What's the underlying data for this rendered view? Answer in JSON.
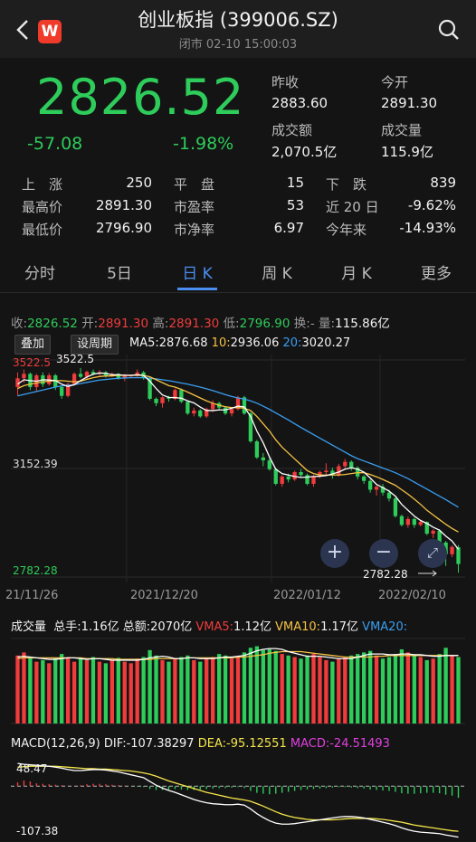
{
  "header": {
    "title": "创业板指 (399006.SZ)",
    "subtitle": "闭市 02-10 15:00:03",
    "logo_text": "W"
  },
  "quote": {
    "price": "2826.52",
    "change": "-57.08",
    "change_pct": "-1.98%",
    "prev_close_label": "昨收",
    "prev_close": "2883.60",
    "open_label": "今开",
    "open": "2891.30",
    "amount_label": "成交额",
    "amount": "2,070.5亿",
    "volume_label": "成交量",
    "volume": "115.9亿"
  },
  "stats": {
    "rise_label": "上　涨",
    "rise": "250",
    "flat_label": "平　盘",
    "flat": "15",
    "fall_label": "下　跌",
    "fall": "839",
    "high_label": "最高价",
    "high": "2891.30",
    "pe_label": "市盈率",
    "pe": "53",
    "d20_label": "近 20 日",
    "d20": "-9.62%",
    "low_label": "最低价",
    "low": "2796.90",
    "pb_label": "市净率",
    "pb": "6.97",
    "ytd_label": "今年来",
    "ytd": "-14.93%"
  },
  "tabs": [
    "分时",
    "5日",
    "日 K",
    "周 K",
    "月 K",
    "更多"
  ],
  "active_tab": "日 K",
  "kline_info": {
    "close_l": "收:",
    "close": "2826.52",
    "open_l": "开:",
    "open": "2891.30",
    "high_l": "高:",
    "high": "2891.30",
    "low_l": "低:",
    "low": "2796.90",
    "chg_l": "换:",
    "chg": "-",
    "vol_l": "量:",
    "vol": "115.86亿"
  },
  "buttons": {
    "overlay": "叠加",
    "period": "设周期"
  },
  "ma": {
    "ma5_l": "MA5:",
    "ma5": "2876.68",
    "ma10_l": "10:",
    "ma10": "2936.06",
    "ma20_l": "20:",
    "ma20": "3020.27"
  },
  "kaxis": {
    "top": "3522.5",
    "mid": "3152.39",
    "bottom": "2782.28",
    "low_marker": "2782.28"
  },
  "dates": [
    "21/11/26",
    "2021/12/20",
    "2022/01/12",
    "2022/02/10"
  ],
  "zoom": {
    "in": "+",
    "out": "−"
  },
  "vol_info": {
    "label": "成交量",
    "total_l": "总手:",
    "total": "1.16亿",
    "amount_l": "总额:",
    "amount": "2070亿",
    "vma5_l": "VMA5:",
    "vma5": "1.12亿",
    "vma10_l": "VMA10:",
    "vma10": "1.17亿",
    "vma20_l": "VMA20:"
  },
  "macd_info": {
    "label": "MACD(12,26,9)",
    "dif_l": "DIF:",
    "dif": "-107.38297",
    "dea_l": "DEA:",
    "dea": "-95.12551",
    "macd_l": "MACD:",
    "macd": "-24.51493"
  },
  "macd_axis": {
    "top": "48.47",
    "bottom": "-107.38"
  },
  "colors": {
    "up": "#f03c3c",
    "down": "#2ecc5a",
    "ma5": "#ffffff",
    "ma10": "#f5c244",
    "ma20": "#3a9ef0",
    "accent": "#4a8ef0"
  },
  "chart_data": {
    "type": "candlestick",
    "ylim": [
      2782.28,
      3522.5
    ],
    "candles": [
      [
        3430,
        3460,
        3400,
        3480
      ],
      [
        3460,
        3475,
        3445,
        3490
      ],
      [
        3475,
        3430,
        3420,
        3480
      ],
      [
        3430,
        3470,
        3415,
        3475
      ],
      [
        3470,
        3440,
        3430,
        3480
      ],
      [
        3440,
        3470,
        3435,
        3478
      ],
      [
        3470,
        3430,
        3420,
        3475
      ],
      [
        3430,
        3400,
        3390,
        3435
      ],
      [
        3400,
        3440,
        3395,
        3445
      ],
      [
        3440,
        3475,
        3435,
        3480
      ],
      [
        3475,
        3465,
        3460,
        3495
      ],
      [
        3465,
        3482,
        3455,
        3486
      ],
      [
        3482,
        3475,
        3470,
        3490
      ],
      [
        3475,
        3480,
        3470,
        3488
      ],
      [
        3480,
        3470,
        3462,
        3485
      ],
      [
        3470,
        3475,
        3465,
        3480
      ],
      [
        3475,
        3460,
        3455,
        3478
      ],
      [
        3460,
        3470,
        3450,
        3475
      ],
      [
        3470,
        3470,
        3460,
        3472
      ],
      [
        3470,
        3480,
        3465,
        3490
      ],
      [
        3480,
        3460,
        3455,
        3485
      ],
      [
        3460,
        3390,
        3385,
        3462
      ],
      [
        3390,
        3375,
        3365,
        3395
      ],
      [
        3375,
        3395,
        3360,
        3398
      ],
      [
        3395,
        3390,
        3380,
        3400
      ],
      [
        3390,
        3420,
        3385,
        3425
      ],
      [
        3420,
        3380,
        3375,
        3425
      ],
      [
        3380,
        3340,
        3335,
        3385
      ],
      [
        3340,
        3350,
        3330,
        3360
      ],
      [
        3350,
        3330,
        3325,
        3355
      ],
      [
        3330,
        3355,
        3325,
        3360
      ],
      [
        3355,
        3375,
        3345,
        3385
      ],
      [
        3375,
        3360,
        3352,
        3380
      ],
      [
        3360,
        3340,
        3335,
        3365
      ],
      [
        3340,
        3355,
        3330,
        3360
      ],
      [
        3355,
        3395,
        3350,
        3400
      ],
      [
        3395,
        3340,
        3335,
        3400
      ],
      [
        3340,
        3245,
        3240,
        3345
      ],
      [
        3245,
        3190,
        3185,
        3250
      ],
      [
        3190,
        3180,
        3160,
        3205
      ],
      [
        3180,
        3150,
        3145,
        3190
      ],
      [
        3150,
        3100,
        3095,
        3155
      ],
      [
        3100,
        3125,
        3090,
        3130
      ],
      [
        3125,
        3115,
        3105,
        3135
      ],
      [
        3115,
        3140,
        3110,
        3145
      ],
      [
        3140,
        3130,
        3120,
        3150
      ],
      [
        3130,
        3100,
        3095,
        3135
      ],
      [
        3100,
        3125,
        3090,
        3130
      ],
      [
        3125,
        3140,
        3120,
        3145
      ],
      [
        3140,
        3145,
        3130,
        3170
      ],
      [
        3145,
        3130,
        3118,
        3155
      ],
      [
        3130,
        3160,
        3125,
        3168
      ],
      [
        3160,
        3175,
        3150,
        3185
      ],
      [
        3175,
        3155,
        3145,
        3180
      ],
      [
        3155,
        3125,
        3115,
        3160
      ],
      [
        3125,
        3110,
        3100,
        3130
      ],
      [
        3110,
        3080,
        3070,
        3115
      ],
      [
        3080,
        3090,
        3060,
        3095
      ],
      [
        3090,
        3070,
        3060,
        3100
      ],
      [
        3070,
        3050,
        3040,
        3080
      ],
      [
        3050,
        2990,
        2985,
        3055
      ],
      [
        2990,
        2960,
        2955,
        2995
      ],
      [
        2960,
        2980,
        2950,
        2988
      ],
      [
        2980,
        2960,
        2950,
        2985
      ],
      [
        2960,
        2970,
        2955,
        2975
      ],
      [
        2970,
        2930,
        2925,
        2972
      ],
      [
        2930,
        2940,
        2915,
        2945
      ],
      [
        2940,
        2900,
        2895,
        2945
      ],
      [
        2900,
        2860,
        2820,
        2905
      ],
      [
        2860,
        2885,
        2850,
        2890
      ],
      [
        2883.6,
        2826.52,
        2796.9,
        2891.3
      ]
    ],
    "ma5": [
      3440,
      3455,
      3452,
      3450,
      3455,
      3454,
      3452,
      3440,
      3432,
      3438,
      3452,
      3464,
      3474,
      3478,
      3477,
      3472,
      3472,
      3470,
      3470,
      3472,
      3470,
      3450,
      3425,
      3403,
      3395,
      3394,
      3392,
      3383,
      3376,
      3362,
      3350,
      3350,
      3352,
      3352,
      3358,
      3365,
      3362,
      3330,
      3280,
      3240,
      3192,
      3150,
      3135,
      3130,
      3125,
      3122,
      3123,
      3125,
      3126,
      3128,
      3134,
      3140,
      3150,
      3155,
      3150,
      3140,
      3120,
      3098,
      3087,
      3075,
      3058,
      3030,
      3010,
      2990,
      2975,
      2965,
      2952,
      2942,
      2922,
      2905,
      2876.68
    ],
    "ma10": [
      3425,
      3435,
      3440,
      3444,
      3448,
      3450,
      3452,
      3452,
      3450,
      3448,
      3450,
      3456,
      3462,
      3466,
      3468,
      3468,
      3470,
      3470,
      3470,
      3470,
      3470,
      3465,
      3455,
      3445,
      3435,
      3430,
      3422,
      3413,
      3403,
      3393,
      3383,
      3375,
      3368,
      3363,
      3360,
      3360,
      3358,
      3350,
      3330,
      3305,
      3280,
      3250,
      3225,
      3205,
      3185,
      3165,
      3145,
      3135,
      3130,
      3130,
      3130,
      3130,
      3132,
      3135,
      3138,
      3138,
      3132,
      3124,
      3115,
      3105,
      3095,
      3080,
      3065,
      3048,
      3030,
      3010,
      2994,
      2978,
      2962,
      2948,
      2936.06
    ],
    "ma20": [
      3400,
      3405,
      3410,
      3415,
      3420,
      3425,
      3430,
      3434,
      3436,
      3438,
      3442,
      3446,
      3450,
      3454,
      3456,
      3458,
      3460,
      3461,
      3462,
      3462,
      3462,
      3460,
      3458,
      3455,
      3452,
      3448,
      3444,
      3440,
      3435,
      3430,
      3424,
      3418,
      3411,
      3404,
      3398,
      3393,
      3389,
      3383,
      3375,
      3365,
      3354,
      3342,
      3330,
      3318,
      3305,
      3292,
      3280,
      3268,
      3256,
      3244,
      3232,
      3220,
      3208,
      3196,
      3186,
      3178,
      3170,
      3162,
      3154,
      3146,
      3138,
      3128,
      3118,
      3106,
      3094,
      3082,
      3070,
      3058,
      3046,
      3033,
      3020.27
    ],
    "volumes": [
      88,
      92,
      85,
      80,
      82,
      78,
      85,
      90,
      86,
      80,
      84,
      82,
      86,
      80,
      78,
      82,
      85,
      80,
      78,
      84,
      86,
      95,
      88,
      82,
      80,
      84,
      86,
      88,
      82,
      80,
      84,
      86,
      90,
      88,
      84,
      86,
      92,
      98,
      100,
      95,
      96,
      94,
      90,
      88,
      86,
      84,
      88,
      90,
      86,
      82,
      80,
      84,
      86,
      88,
      90,
      92,
      94,
      88,
      84,
      86,
      90,
      96,
      92,
      88,
      86,
      82,
      84,
      90,
      98,
      88,
      86
    ],
    "vma5": [
      86,
      87,
      86,
      85,
      84,
      83,
      83,
      84,
      85,
      85,
      84,
      83,
      84,
      84,
      83,
      82,
      82,
      82,
      82,
      82,
      83,
      85,
      86,
      87,
      86,
      84,
      84,
      85,
      85,
      84,
      84,
      84,
      85,
      86,
      86,
      87,
      88,
      91,
      94,
      96,
      97,
      97,
      96,
      93,
      91,
      89,
      87,
      87,
      87,
      86,
      85,
      84,
      84,
      84,
      86,
      88,
      90,
      90,
      90,
      89,
      89,
      90,
      90,
      89,
      89,
      88,
      87,
      87,
      88,
      88,
      88
    ],
    "vma10": [
      84,
      85,
      85,
      85,
      85,
      85,
      85,
      85,
      85,
      85,
      85,
      84,
      84,
      84,
      84,
      84,
      83,
      83,
      83,
      83,
      83,
      83,
      84,
      84,
      84,
      84,
      84,
      85,
      85,
      85,
      85,
      85,
      85,
      85,
      85,
      86,
      86,
      87,
      88,
      89,
      91,
      92,
      93,
      93,
      93,
      93,
      92,
      91,
      90,
      89,
      88,
      87,
      86,
      86,
      86,
      86,
      86,
      87,
      87,
      88,
      88,
      88,
      88,
      88,
      88,
      88,
      88,
      88,
      88,
      88,
      88
    ],
    "macd_hist": [
      8,
      12,
      10,
      6,
      5,
      4,
      3,
      2,
      1,
      0,
      2,
      4,
      5,
      5,
      4,
      3,
      2,
      1,
      0,
      -1,
      -2,
      -6,
      -8,
      -8,
      -7,
      -6,
      -7,
      -8,
      -8,
      -7,
      -6,
      -5,
      -4,
      -4,
      -3,
      -2,
      -4,
      -10,
      -14,
      -16,
      -17,
      -16,
      -14,
      -12,
      -10,
      -8,
      -7,
      -6,
      -5,
      -4,
      -3,
      -2,
      -2,
      -3,
      -4,
      -5,
      -7,
      -8,
      -9,
      -10,
      -12,
      -15,
      -16,
      -16,
      -15,
      -14,
      -14,
      -15,
      -18,
      -20,
      -24.5
    ],
    "dif": [
      48,
      46,
      45,
      44,
      43,
      42,
      40,
      38,
      35,
      33,
      33,
      34,
      35,
      35,
      34,
      32,
      30,
      27,
      24,
      21,
      18,
      10,
      2,
      -4,
      -9,
      -13,
      -18,
      -23,
      -28,
      -32,
      -35,
      -37,
      -38,
      -39,
      -39,
      -38,
      -40,
      -48,
      -58,
      -66,
      -73,
      -78,
      -80,
      -80,
      -79,
      -77,
      -75,
      -73,
      -71,
      -69,
      -67,
      -65,
      -64,
      -64,
      -65,
      -67,
      -70,
      -73,
      -76,
      -79,
      -83,
      -88,
      -92,
      -95,
      -97,
      -98,
      -99,
      -100,
      -103,
      -105,
      -107.38
    ],
    "dea": [
      40,
      41,
      42,
      42,
      42,
      42,
      42,
      41,
      40,
      39,
      38,
      37,
      37,
      36,
      36,
      35,
      34,
      33,
      32,
      30,
      28,
      25,
      21,
      16,
      11,
      7,
      3,
      -1,
      -5,
      -9,
      -13,
      -16,
      -19,
      -22,
      -25,
      -27,
      -29,
      -32,
      -37,
      -42,
      -48,
      -54,
      -59,
      -63,
      -66,
      -68,
      -70,
      -71,
      -71,
      -71,
      -71,
      -70,
      -69,
      -68,
      -68,
      -68,
      -68,
      -69,
      -70,
      -72,
      -74,
      -76,
      -79,
      -82,
      -84,
      -86,
      -88,
      -90,
      -92,
      -94,
      -95.13
    ]
  }
}
